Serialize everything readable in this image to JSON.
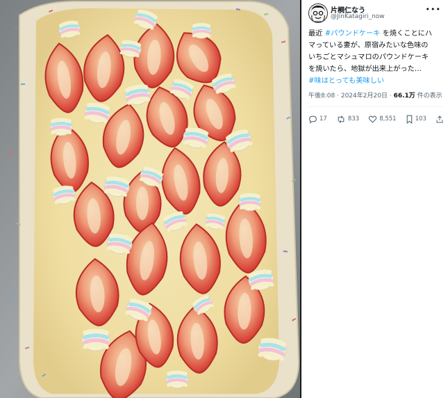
{
  "tweet": {
    "author": {
      "name": "片桐仁なう",
      "handle": "@JinKatagiri_now"
    },
    "more_icon": "more-dots-icon",
    "body": {
      "line1_prefix": "最近 ",
      "line1_hashtag": "#パウンドケーキ",
      "line1_suffix": " を焼くことにハ",
      "line2": "マっている妻が、原宿みたいな色味の",
      "line3": "いちごとマシュマロのパウンドケーキ",
      "line4": "を焼いたら、地獄が出来上がった…",
      "line5_hashtag": "#味はとっても美味しい"
    },
    "meta": {
      "time": "午後8:08",
      "dot1": "·",
      "date": "2024年2月20日",
      "dot2": "·",
      "views_count": "66.1万",
      "views_label": " 件の表示"
    },
    "actions": {
      "reply_count": "17",
      "retweet_count": "833",
      "like_count": "8,551",
      "bookmark_count": "103"
    }
  },
  "photo": {
    "subject": "strawberry-marshmallow-pound-cake-photo"
  }
}
